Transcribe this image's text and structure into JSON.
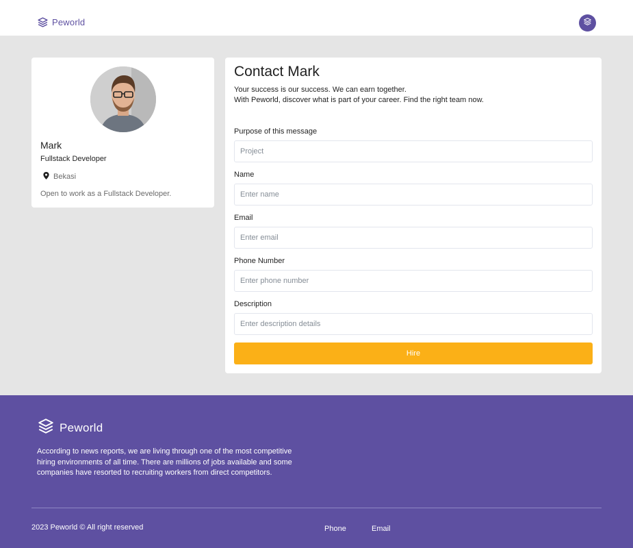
{
  "colors": {
    "primary": "#5e50a1",
    "accent": "#fbb017",
    "background": "#e5e5e5",
    "card": "#ffffff"
  },
  "navbar": {
    "brand": "Peworld",
    "logo_icon": "layers-icon",
    "avatar_icon": "layers-icon"
  },
  "profile": {
    "name": "Mark",
    "role": "Fullstack Developer",
    "location": "Bekasi",
    "location_icon": "map-pin-icon",
    "description": "Open to work as a Fullstack Developer."
  },
  "contact": {
    "title": "Contact Mark",
    "subtitle_line1": "Your success is our success. We can earn together.",
    "subtitle_line2": "With Peworld, discover what is part of your career. Find the right team now.",
    "fields": {
      "purpose": {
        "label": "Purpose of this message",
        "placeholder": "Project"
      },
      "name": {
        "label": "Name",
        "placeholder": "Enter name"
      },
      "email": {
        "label": "Email",
        "placeholder": "Enter email"
      },
      "phone": {
        "label": "Phone Number",
        "placeholder": "Enter phone number"
      },
      "description": {
        "label": "Description",
        "placeholder": "Enter description details"
      }
    },
    "submit_label": "Hire"
  },
  "footer": {
    "brand": "Peworld",
    "text": "According to news reports, we are living through one of the most competitive hiring environments of all time. There are millions of jobs available and some companies have resorted to recruiting workers from direct competitors.",
    "copyright": "2023 Peworld © All right reserved",
    "links": {
      "phone": "Phone",
      "email": "Email"
    }
  }
}
